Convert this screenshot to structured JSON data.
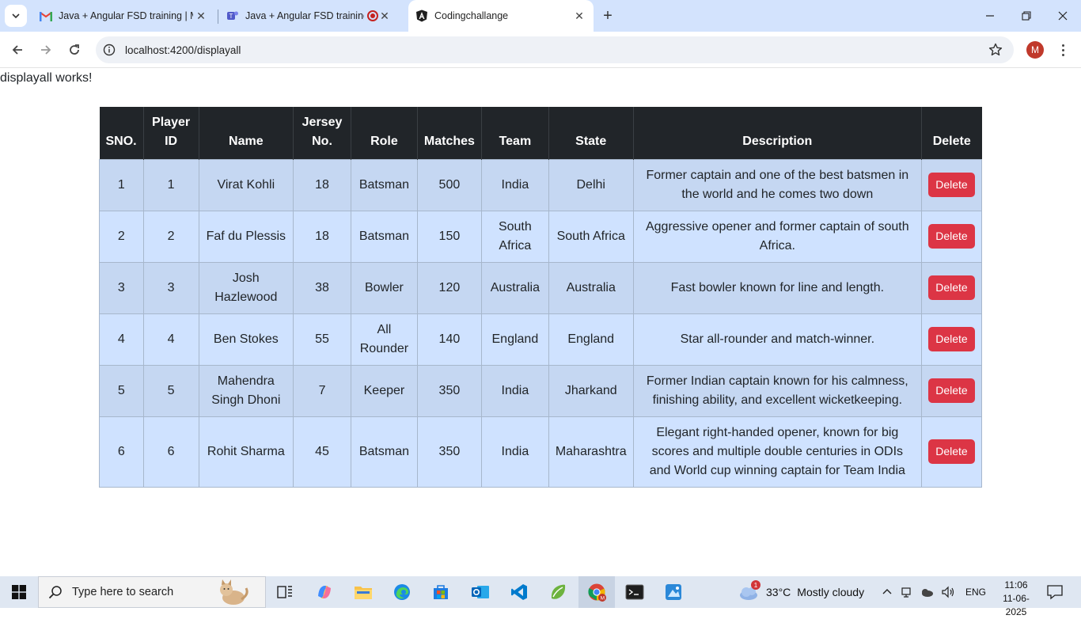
{
  "browser": {
    "tabs": [
      {
        "title": "Java + Angular FSD training | M",
        "icon": "gmail-icon"
      },
      {
        "title": "Java + Angular FSD training",
        "icon": "teams-icon"
      },
      {
        "title": "Codingchallange",
        "icon": "angular-icon"
      }
    ],
    "url": "localhost:4200/displayall",
    "profile_initial": "M"
  },
  "page": {
    "message": "displayall works!",
    "table": {
      "headers": {
        "sno": "SNO.",
        "player_id": "Player ID",
        "name": "Name",
        "jersey": "Jersey No.",
        "role": "Role",
        "matches": "Matches",
        "team": "Team",
        "state": "State",
        "description": "Description",
        "delete": "Delete"
      },
      "delete_label": "Delete",
      "rows": [
        {
          "sno": "1",
          "player_id": "1",
          "name": "Virat Kohli",
          "jersey": "18",
          "role": "Batsman",
          "matches": "500",
          "team": "India",
          "state": "Delhi",
          "description": "Former captain and one of the best batsmen in the world and he comes two down"
        },
        {
          "sno": "2",
          "player_id": "2",
          "name": "Faf du Plessis",
          "jersey": "18",
          "role": "Batsman",
          "matches": "150",
          "team": "South Africa",
          "state": "South Africa",
          "description": "Aggressive opener and former captain of south Africa."
        },
        {
          "sno": "3",
          "player_id": "3",
          "name": "Josh Hazlewood",
          "jersey": "38",
          "role": "Bowler",
          "matches": "120",
          "team": "Australia",
          "state": "Australia",
          "description": "Fast bowler known for line and length."
        },
        {
          "sno": "4",
          "player_id": "4",
          "name": "Ben Stokes",
          "jersey": "55",
          "role": "All Rounder",
          "matches": "140",
          "team": "England",
          "state": "England",
          "description": "Star all-rounder and match-winner."
        },
        {
          "sno": "5",
          "player_id": "5",
          "name": "Mahendra Singh Dhoni",
          "jersey": "7",
          "role": "Keeper",
          "matches": "350",
          "team": "India",
          "state": "Jharkand",
          "description": "Former Indian captain known for his calmness, finishing ability, and excellent wicketkeeping."
        },
        {
          "sno": "6",
          "player_id": "6",
          "name": "Rohit Sharma",
          "jersey": "45",
          "role": "Batsman",
          "matches": "350",
          "team": "India",
          "state": "Maharashtra",
          "description": "Elegant right-handed opener, known for big scores and multiple double centuries in ODIs and World cup winning captain for Team India"
        }
      ]
    }
  },
  "taskbar": {
    "search_placeholder": "Type here to search",
    "weather": {
      "temp": "33°C",
      "condition": "Mostly cloudy",
      "badge": "1"
    },
    "language": "ENG",
    "time": "11:06",
    "date": "11-06-2025"
  },
  "colors": {
    "header_bg": "#212529",
    "row_odd": "#c5d7f2",
    "row_even": "#cfe2ff",
    "delete_btn": "#dc3545",
    "tabstrip": "#d3e3fd"
  }
}
